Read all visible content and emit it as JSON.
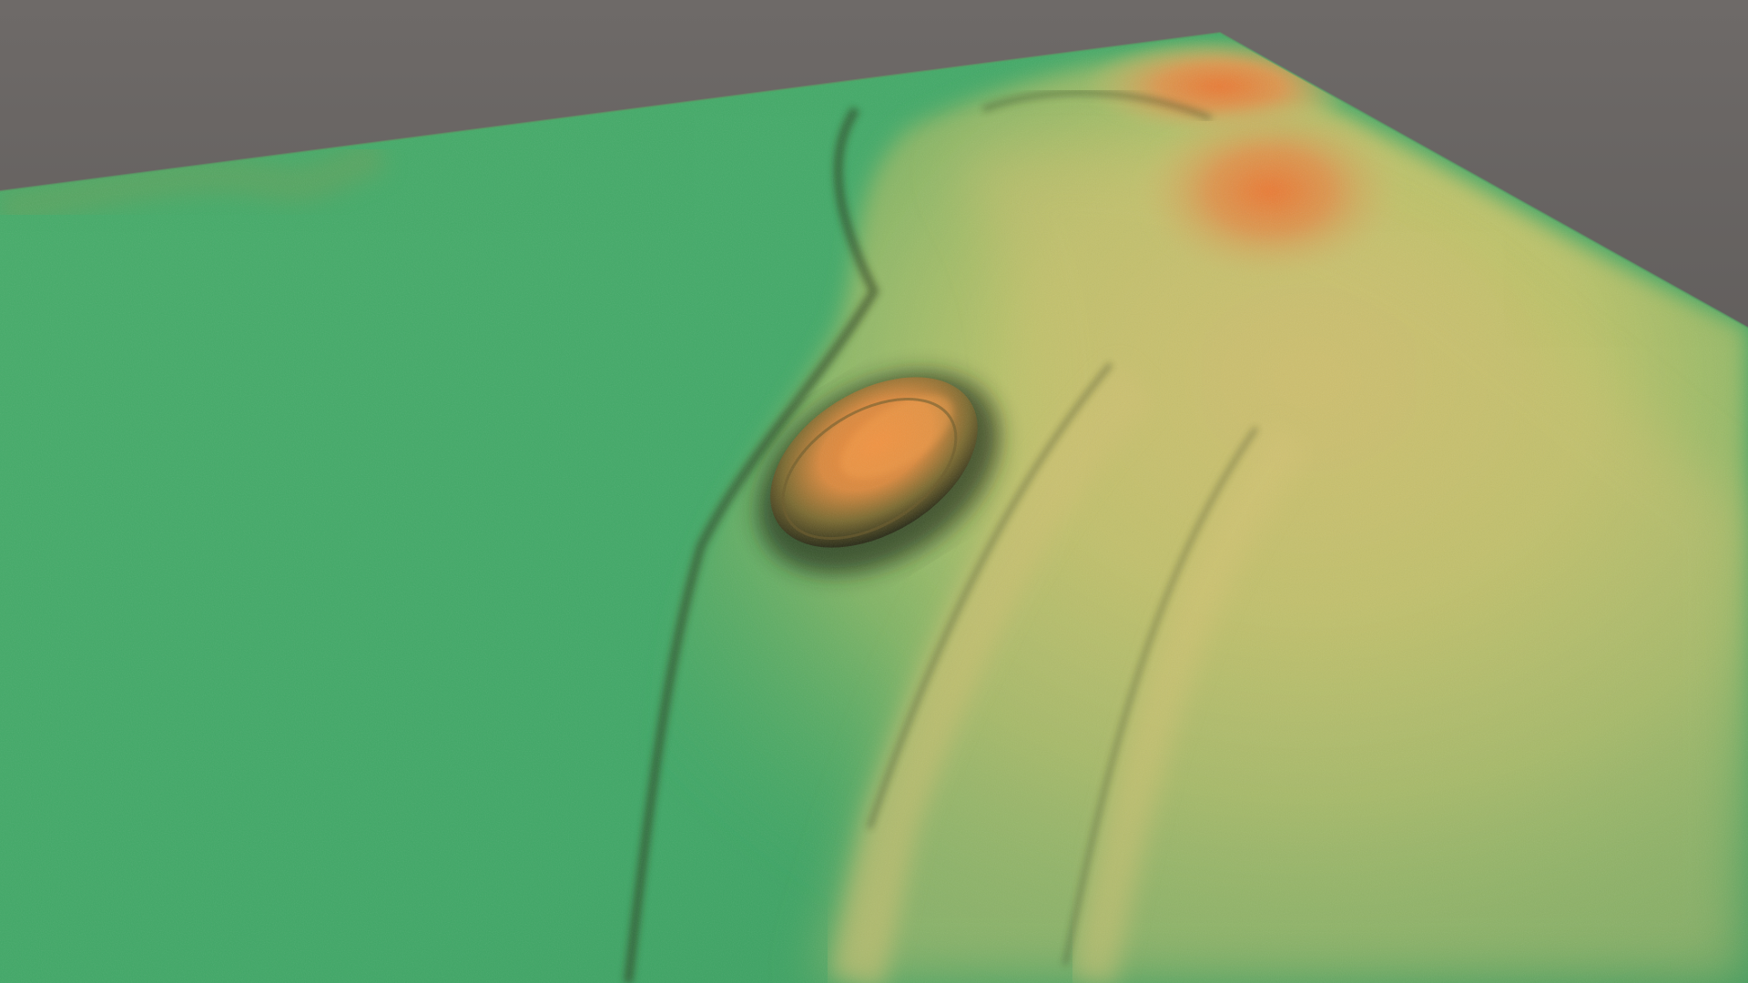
{
  "scene": {
    "kind": "terrain-elevation-render",
    "colors": {
      "background_top": "#6e6a68",
      "background_bottom": "#4c4a49",
      "lowland_green": "#3fa766",
      "mid_green": "#4aa660",
      "highland_yellow": "#cdbf6a",
      "peak_orange": "#e07a38",
      "shadow": "#1f2a18"
    },
    "features": [
      "flat-plain",
      "ridge-system",
      "oval-mound",
      "twin-peaks"
    ]
  }
}
